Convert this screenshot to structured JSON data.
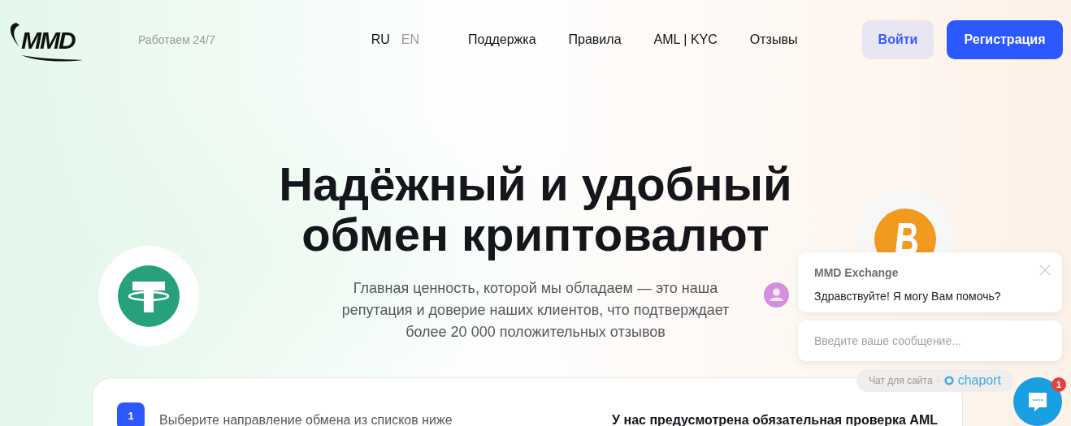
{
  "header": {
    "logo": "MMD",
    "tagline": "Работаем 24/7",
    "languages": [
      {
        "label": "RU",
        "selected": true
      },
      {
        "label": "EN",
        "selected": false
      }
    ],
    "nav": [
      "Поддержка",
      "Правила",
      "AML | KYC",
      "Отзывы"
    ],
    "login": "Войти",
    "register": "Регистрация"
  },
  "hero": {
    "title_lines": [
      "Надёжный и удобный",
      "обмен криптовалют"
    ],
    "subtitle_lines": [
      "Главная ценность, которой мы обладаем — это наша",
      "репутация и доверие наших клиентов, что подтверждает",
      "более 20 000 положительных отзывов"
    ]
  },
  "card": {
    "step_number": "1",
    "step_text": "Выберите направление обмена из списков ниже",
    "notice": "У нас предусмотрена обязательная проверка AML"
  },
  "chat": {
    "sender": "MMD Exchange",
    "message": "Здравствуйте! Я могу Вам помочь?",
    "placeholder": "Введите ваше сообщение...",
    "footer_text": "Чат для сайта",
    "separator": "·",
    "brand": "chaport",
    "unread": "1"
  }
}
